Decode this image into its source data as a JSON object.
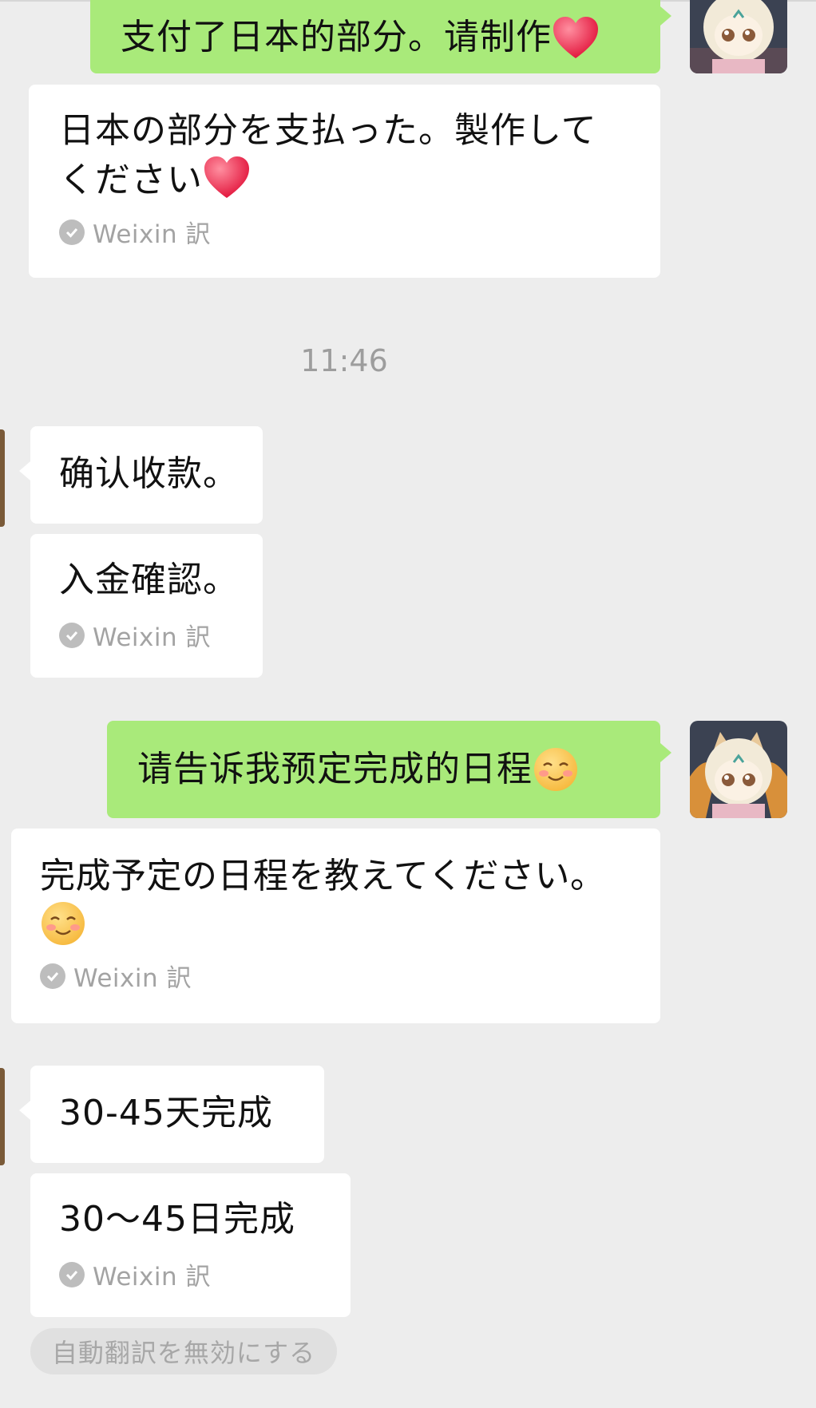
{
  "messages": {
    "m1_text": "支付了日本的部分。请制作",
    "m1_translation_line1": "日本の部分を支払った。製作して",
    "m1_translation_line2": "ください",
    "m2_text": "确认收款。",
    "m2_translation": "入金確認。",
    "m3_text": "请告诉我预定完成的日程",
    "m3_translation": "完成予定の日程を教えてください。",
    "m4_text": "30-45天完成",
    "m4_translation": "30～45日完成"
  },
  "translation_source_label": "Weixin 訳",
  "timestamp": "11:46",
  "disable_auto_translate_label": "自動翻訳を無効にする",
  "icons": {
    "heart": "red-heart-emoji",
    "smile": "smiling-face-closed-eyes-emoji",
    "check": "check-circle-icon",
    "avatar": "plush-doll-avatar"
  },
  "colors": {
    "background": "#ededed",
    "sent_bubble": "#a9ea7a",
    "received_bubble": "#ffffff",
    "muted_text": "#a3a3a3"
  }
}
